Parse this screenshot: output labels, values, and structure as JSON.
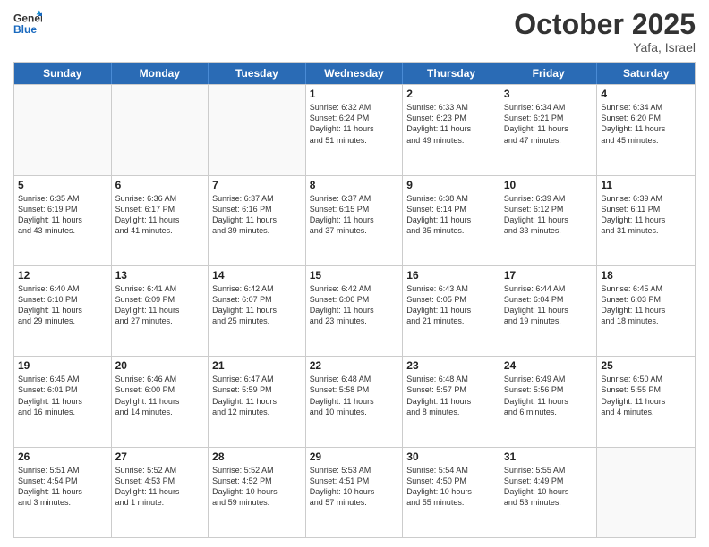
{
  "header": {
    "logo_line1": "General",
    "logo_line2": "Blue",
    "month": "October 2025",
    "location": "Yafa, Israel"
  },
  "days_of_week": [
    "Sunday",
    "Monday",
    "Tuesday",
    "Wednesday",
    "Thursday",
    "Friday",
    "Saturday"
  ],
  "weeks": [
    [
      {
        "day": "",
        "info": ""
      },
      {
        "day": "",
        "info": ""
      },
      {
        "day": "",
        "info": ""
      },
      {
        "day": "1",
        "info": "Sunrise: 6:32 AM\nSunset: 6:24 PM\nDaylight: 11 hours\nand 51 minutes."
      },
      {
        "day": "2",
        "info": "Sunrise: 6:33 AM\nSunset: 6:23 PM\nDaylight: 11 hours\nand 49 minutes."
      },
      {
        "day": "3",
        "info": "Sunrise: 6:34 AM\nSunset: 6:21 PM\nDaylight: 11 hours\nand 47 minutes."
      },
      {
        "day": "4",
        "info": "Sunrise: 6:34 AM\nSunset: 6:20 PM\nDaylight: 11 hours\nand 45 minutes."
      }
    ],
    [
      {
        "day": "5",
        "info": "Sunrise: 6:35 AM\nSunset: 6:19 PM\nDaylight: 11 hours\nand 43 minutes."
      },
      {
        "day": "6",
        "info": "Sunrise: 6:36 AM\nSunset: 6:17 PM\nDaylight: 11 hours\nand 41 minutes."
      },
      {
        "day": "7",
        "info": "Sunrise: 6:37 AM\nSunset: 6:16 PM\nDaylight: 11 hours\nand 39 minutes."
      },
      {
        "day": "8",
        "info": "Sunrise: 6:37 AM\nSunset: 6:15 PM\nDaylight: 11 hours\nand 37 minutes."
      },
      {
        "day": "9",
        "info": "Sunrise: 6:38 AM\nSunset: 6:14 PM\nDaylight: 11 hours\nand 35 minutes."
      },
      {
        "day": "10",
        "info": "Sunrise: 6:39 AM\nSunset: 6:12 PM\nDaylight: 11 hours\nand 33 minutes."
      },
      {
        "day": "11",
        "info": "Sunrise: 6:39 AM\nSunset: 6:11 PM\nDaylight: 11 hours\nand 31 minutes."
      }
    ],
    [
      {
        "day": "12",
        "info": "Sunrise: 6:40 AM\nSunset: 6:10 PM\nDaylight: 11 hours\nand 29 minutes."
      },
      {
        "day": "13",
        "info": "Sunrise: 6:41 AM\nSunset: 6:09 PM\nDaylight: 11 hours\nand 27 minutes."
      },
      {
        "day": "14",
        "info": "Sunrise: 6:42 AM\nSunset: 6:07 PM\nDaylight: 11 hours\nand 25 minutes."
      },
      {
        "day": "15",
        "info": "Sunrise: 6:42 AM\nSunset: 6:06 PM\nDaylight: 11 hours\nand 23 minutes."
      },
      {
        "day": "16",
        "info": "Sunrise: 6:43 AM\nSunset: 6:05 PM\nDaylight: 11 hours\nand 21 minutes."
      },
      {
        "day": "17",
        "info": "Sunrise: 6:44 AM\nSunset: 6:04 PM\nDaylight: 11 hours\nand 19 minutes."
      },
      {
        "day": "18",
        "info": "Sunrise: 6:45 AM\nSunset: 6:03 PM\nDaylight: 11 hours\nand 18 minutes."
      }
    ],
    [
      {
        "day": "19",
        "info": "Sunrise: 6:45 AM\nSunset: 6:01 PM\nDaylight: 11 hours\nand 16 minutes."
      },
      {
        "day": "20",
        "info": "Sunrise: 6:46 AM\nSunset: 6:00 PM\nDaylight: 11 hours\nand 14 minutes."
      },
      {
        "day": "21",
        "info": "Sunrise: 6:47 AM\nSunset: 5:59 PM\nDaylight: 11 hours\nand 12 minutes."
      },
      {
        "day": "22",
        "info": "Sunrise: 6:48 AM\nSunset: 5:58 PM\nDaylight: 11 hours\nand 10 minutes."
      },
      {
        "day": "23",
        "info": "Sunrise: 6:48 AM\nSunset: 5:57 PM\nDaylight: 11 hours\nand 8 minutes."
      },
      {
        "day": "24",
        "info": "Sunrise: 6:49 AM\nSunset: 5:56 PM\nDaylight: 11 hours\nand 6 minutes."
      },
      {
        "day": "25",
        "info": "Sunrise: 6:50 AM\nSunset: 5:55 PM\nDaylight: 11 hours\nand 4 minutes."
      }
    ],
    [
      {
        "day": "26",
        "info": "Sunrise: 5:51 AM\nSunset: 4:54 PM\nDaylight: 11 hours\nand 3 minutes."
      },
      {
        "day": "27",
        "info": "Sunrise: 5:52 AM\nSunset: 4:53 PM\nDaylight: 11 hours\nand 1 minute."
      },
      {
        "day": "28",
        "info": "Sunrise: 5:52 AM\nSunset: 4:52 PM\nDaylight: 10 hours\nand 59 minutes."
      },
      {
        "day": "29",
        "info": "Sunrise: 5:53 AM\nSunset: 4:51 PM\nDaylight: 10 hours\nand 57 minutes."
      },
      {
        "day": "30",
        "info": "Sunrise: 5:54 AM\nSunset: 4:50 PM\nDaylight: 10 hours\nand 55 minutes."
      },
      {
        "day": "31",
        "info": "Sunrise: 5:55 AM\nSunset: 4:49 PM\nDaylight: 10 hours\nand 53 minutes."
      },
      {
        "day": "",
        "info": ""
      }
    ]
  ]
}
